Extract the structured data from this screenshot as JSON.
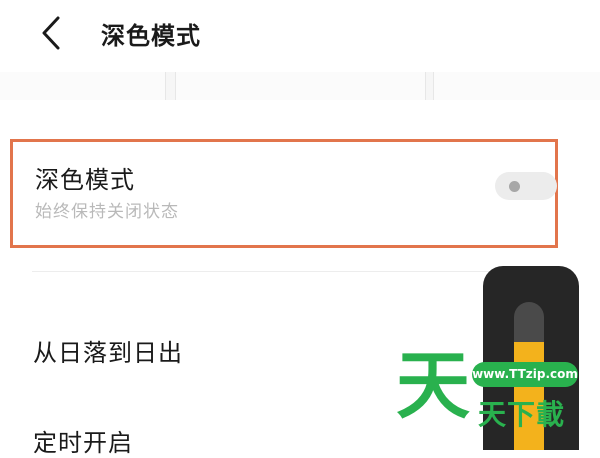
{
  "header": {
    "title": "深色模式"
  },
  "dark_mode": {
    "title": "深色模式",
    "subtitle": "始终保持关闭状态",
    "toggle_on": false
  },
  "options": {
    "sunset_label": "从日落到日出",
    "schedule_label": "定时开启"
  },
  "phone_graphic": {
    "fill_level": 0.73
  },
  "watermark": {
    "badge": "www.TTzip.com",
    "big_char": "天",
    "text": "天下載"
  },
  "colors": {
    "highlight_border": "#e2754c",
    "toggle_track": "#ececec",
    "toggle_knob": "#a7a7a7",
    "watermark_green": "#29b14e",
    "slider_fill": "#f3b21c"
  }
}
